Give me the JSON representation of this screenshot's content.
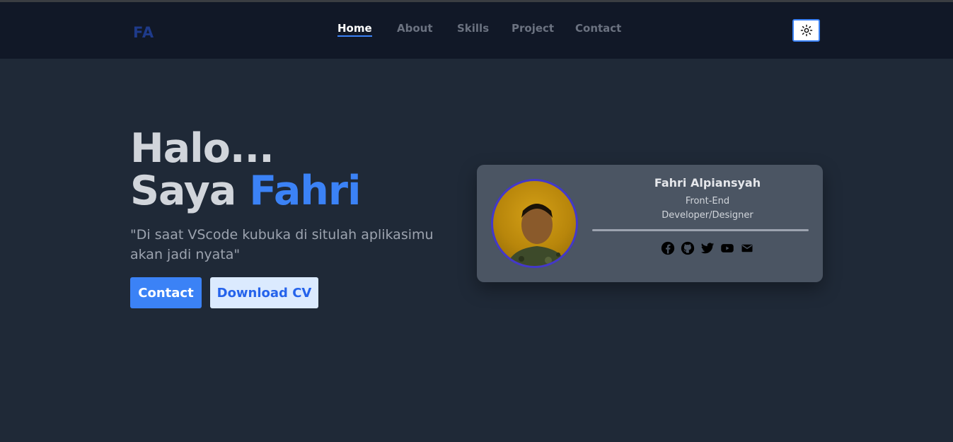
{
  "header": {
    "logo": "FA",
    "nav": [
      {
        "label": "Home",
        "active": true
      },
      {
        "label": "About",
        "active": false
      },
      {
        "label": "Skills",
        "active": false
      },
      {
        "label": "Project",
        "active": false
      },
      {
        "label": "Contact",
        "active": false
      }
    ],
    "theme_toggle_icon": "sun-icon"
  },
  "hero": {
    "line1": "Halo...",
    "line2_prefix": "Saya",
    "line2_name": "Fahri",
    "quote": "\"Di saat VScode kubuka di situlah aplikasimu akan jadi nyata\"",
    "contact_label": "Contact",
    "download_label": "Download CV"
  },
  "profile_card": {
    "name": "Fahri Alpiansyah",
    "role_line1": "Front-End",
    "role_line2": "Developer/Designer",
    "socials": [
      "facebook-icon",
      "github-icon",
      "twitter-icon",
      "youtube-icon",
      "mail-icon"
    ]
  },
  "colors": {
    "background": "#1f2937",
    "header_bg": "#111827",
    "accent": "#3b82f6",
    "card_bg": "#4b5563"
  }
}
